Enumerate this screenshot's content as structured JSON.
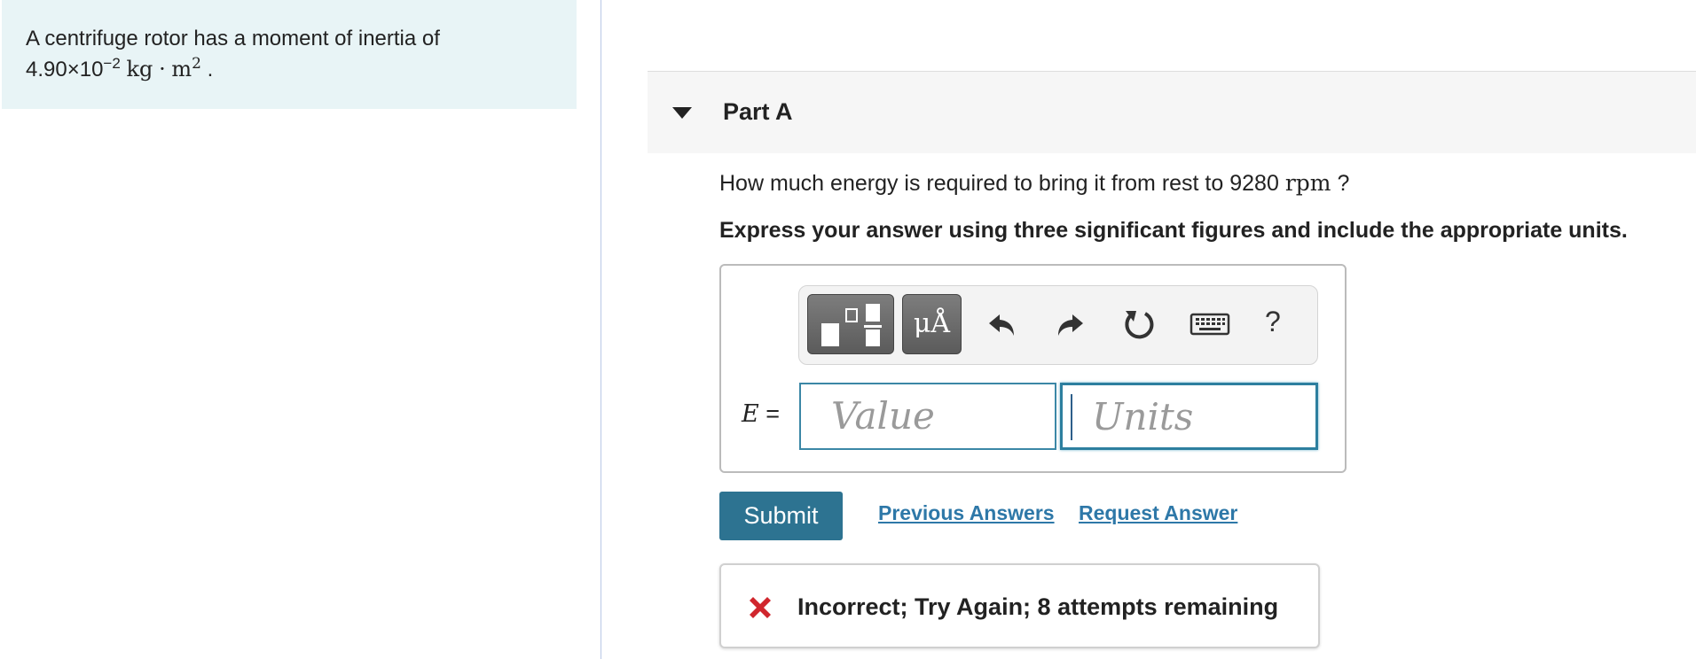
{
  "problem": {
    "text": "A centrifuge rotor has a moment of inertia of",
    "value_mantissa": "4.90×10",
    "value_exponent": "−2",
    "units_kg": "kg",
    "units_dot": "·",
    "units_m": "m",
    "units_m_exp": "2",
    "period": "."
  },
  "part": {
    "title": "Part A"
  },
  "question": {
    "text": "How much energy is required to bring it from rest to 9280",
    "unit": "rpm",
    "end": "?"
  },
  "instruction": "Express your answer using three significant figures and include the appropriate units.",
  "answer": {
    "variable": "E",
    "equals": "=",
    "value_placeholder": "Value",
    "units_placeholder": "Units"
  },
  "toolbar": {
    "symbols_label": "μÅ",
    "help_label": "?"
  },
  "actions": {
    "submit_label": "Submit",
    "previous_answers_label": "Previous Answers",
    "request_answer_label": "Request Answer"
  },
  "feedback": {
    "text": "Incorrect; Try Again; 8 attempts remaining",
    "icon_color": "#d0262d"
  }
}
